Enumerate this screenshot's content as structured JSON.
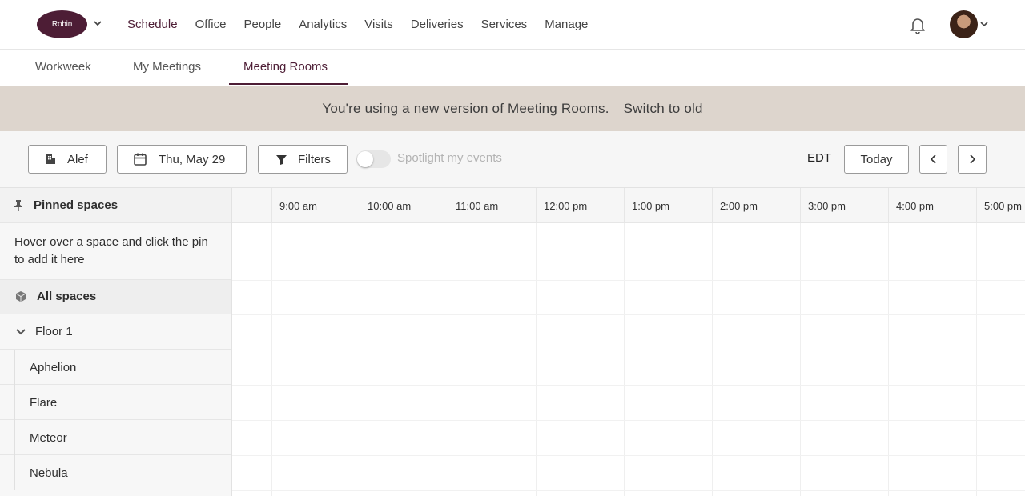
{
  "brand": {
    "logo_text": "Robin",
    "accent": "#4d1d35"
  },
  "nav": {
    "items": [
      {
        "label": "Schedule",
        "active": true
      },
      {
        "label": "Office"
      },
      {
        "label": "People"
      },
      {
        "label": "Analytics"
      },
      {
        "label": "Visits"
      },
      {
        "label": "Deliveries"
      },
      {
        "label": "Services"
      },
      {
        "label": "Manage"
      }
    ],
    "icons": [
      "chevron-down-icon",
      "bell-icon",
      "avatar"
    ]
  },
  "subtabs": [
    {
      "label": "Workweek"
    },
    {
      "label": "My Meetings"
    },
    {
      "label": "Meeting Rooms",
      "active": true
    }
  ],
  "banner": {
    "message": "You're using a new version of Meeting Rooms.",
    "link": "Switch to old",
    "background": "#ddd5cd"
  },
  "toolbar": {
    "building": "Alef",
    "date": "Thu, May 29",
    "filters": "Filters",
    "spotlight_label": "Spotlight my events",
    "spotlight_on": false,
    "timezone": "EDT",
    "today": "Today"
  },
  "sidebar": {
    "pinned_title": "Pinned spaces",
    "pinned_hint": "Hover over a space and click the pin to add it here",
    "all_spaces": "All spaces",
    "floor": "Floor 1",
    "rooms": [
      "Aphelion",
      "Flare",
      "Meteor",
      "Nebula"
    ]
  },
  "timeline": {
    "hours": [
      "9:00 am",
      "10:00 am",
      "11:00 am",
      "12:00 pm",
      "1:00 pm",
      "2:00 pm",
      "3:00 pm",
      "4:00 pm",
      "5:00 pm"
    ]
  }
}
